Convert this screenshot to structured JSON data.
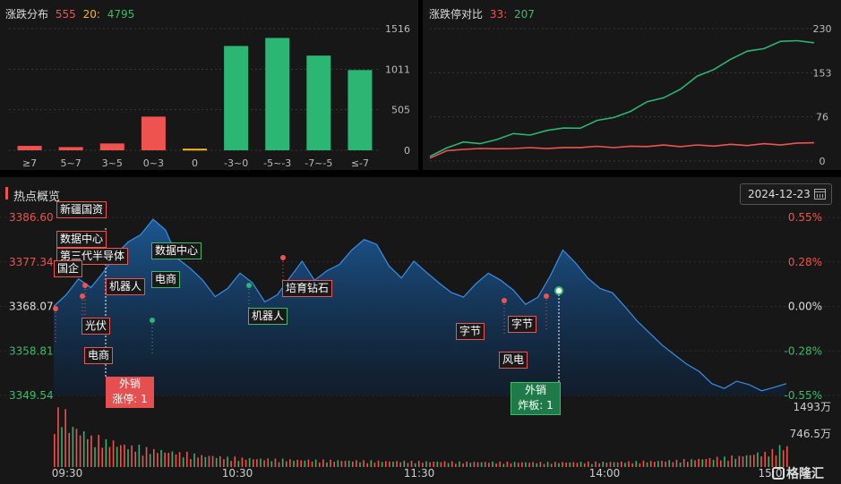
{
  "dist_panel": {
    "title": "涨跌分布",
    "up_count": "555",
    "flat_count": "20:",
    "down_count": "4795",
    "y_ticks": [
      "1516",
      "1011",
      "505",
      "0"
    ]
  },
  "ratio_panel": {
    "title": "涨跌停对比",
    "limit_up": "33:",
    "limit_down": "207",
    "y_ticks": [
      "230",
      "153",
      "76",
      "0"
    ]
  },
  "overview": {
    "title": "热点概览",
    "date": "2024-12-23",
    "y_left": [
      "3386.60",
      "3377.34",
      "3368.07",
      "3358.81",
      "3349.54"
    ],
    "y_right": [
      "0.55%",
      "0.28%",
      "0.00%",
      "-0.28%",
      "-0.55%"
    ],
    "vol_ticks": [
      "1493万",
      "746.5万"
    ],
    "x_ticks": [
      "09:30",
      "10:30",
      "11:30",
      "14:00",
      "15:0"
    ],
    "logo": "格隆汇"
  },
  "tags": {
    "t1": "新疆国资",
    "t2": "数据中心",
    "t3": "第三代半导体",
    "t4": "国企",
    "t5": "机器人",
    "t6": "光伏",
    "t7": "电商",
    "t8": "数据中心",
    "t9": "电商",
    "t10": "机器人",
    "t11": "培育钻石",
    "t12": "字节",
    "t13": "字节",
    "t14": "风电",
    "e1_line1": "外销",
    "e1_line2": "涨停: 1",
    "e2_line1": "外销",
    "e2_line2": "炸板: 1"
  },
  "colors": {
    "up": "#ef5350",
    "down": "#2bb673",
    "flat": "#f5b820",
    "area": "#1e5fa0"
  },
  "chart_data": [
    {
      "type": "bar",
      "title": "涨跌分布",
      "categories": [
        "≥7",
        "5~7",
        "3~5",
        "0~3",
        "0",
        "-3~0",
        "-5~-3",
        "-7~-5",
        "≤-7"
      ],
      "values": [
        55,
        40,
        85,
        420,
        20,
        1300,
        1400,
        1180,
        1000
      ],
      "ylim": [
        0,
        1516
      ]
    },
    {
      "type": "line",
      "title": "涨跌停对比",
      "ylim": [
        0,
        230
      ],
      "series": [
        {
          "values": [
            8,
            25,
            30,
            32,
            38,
            45,
            48,
            52,
            56,
            60,
            68,
            76,
            88,
            100,
            112,
            125,
            145,
            162,
            175,
            190,
            198,
            205,
            210,
            207
          ]
        },
        {
          "values": [
            5,
            18,
            20,
            22,
            21,
            22,
            23,
            22,
            23,
            24,
            25,
            24,
            25,
            26,
            27,
            26,
            27,
            27,
            28,
            28,
            29,
            29,
            30,
            33
          ]
        }
      ]
    },
    {
      "type": "area",
      "title": "热点概览",
      "ylim": [
        3349.54,
        3386.6
      ],
      "x_labels": [
        "09:30",
        "10:30",
        "11:30",
        "14:00",
        "15:0"
      ],
      "values": [
        3368.07,
        3370.5,
        3373.8,
        3372.0,
        3375.2,
        3378.9,
        3381.5,
        3383.0,
        3386.2,
        3384.0,
        3378.0,
        3376.0,
        3373.5,
        3370.1,
        3371.8,
        3375.0,
        3373.0,
        3369.0,
        3370.5,
        3374.0,
        3377.5,
        3373.5,
        3375.5,
        3376.8,
        3379.8,
        3382.0,
        3381.0,
        3376.5,
        3374.0,
        3377.5,
        3375.2,
        3373.0,
        3371.0,
        3370.0,
        3372.8,
        3375.0,
        3373.5,
        3371.5,
        3368.5,
        3370.0,
        3374.5,
        3379.8,
        3377.2,
        3374.0,
        3371.8,
        3370.9,
        3368.0,
        3365.0,
        3362.5,
        3360.0,
        3358.0,
        3356.0,
        3354.5,
        3352.0,
        3351.0,
        3352.5,
        3351.8,
        3350.5,
        3351.2,
        3352.0
      ],
      "volume": [
        1493,
        1100,
        950,
        800,
        700,
        620,
        560,
        500,
        460,
        420,
        380,
        340,
        310,
        280,
        260,
        240,
        230,
        220,
        210,
        200,
        195,
        190,
        185,
        180,
        175,
        170,
        165,
        160,
        160,
        155,
        150,
        150,
        145,
        140,
        140,
        138,
        136,
        134,
        132,
        130,
        130,
        132,
        134,
        136,
        138,
        140,
        145,
        150,
        160,
        170,
        180,
        200,
        220,
        240,
        260,
        290,
        330,
        380,
        450,
        560
      ]
    }
  ]
}
